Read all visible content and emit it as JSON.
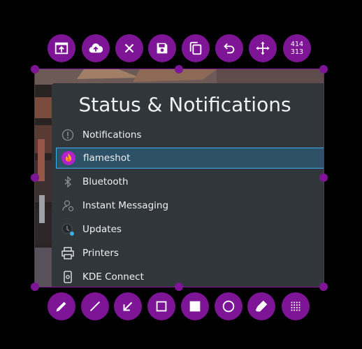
{
  "colors": {
    "accent": "#7e1596",
    "panel": "#31363b",
    "selection": "#2d5166",
    "selection_border": "#3daee9"
  },
  "top_toolbar": {
    "buttons": [
      {
        "name": "upload-to-screen-icon"
      },
      {
        "name": "cloud-upload-icon"
      },
      {
        "name": "close-icon"
      },
      {
        "name": "save-icon"
      },
      {
        "name": "copy-icon"
      },
      {
        "name": "undo-icon"
      },
      {
        "name": "move-icon"
      }
    ],
    "size": {
      "width": "414",
      "height": "313"
    }
  },
  "panel": {
    "title": "Status & Notifications",
    "items": [
      {
        "label": "Notifications",
        "icon": "info-circle-icon"
      },
      {
        "label": "flameshot",
        "icon": "flameshot-icon",
        "selected": true
      },
      {
        "label": "Bluetooth",
        "icon": "bluetooth-icon"
      },
      {
        "label": "Instant Messaging",
        "icon": "user-icon"
      },
      {
        "label": "Updates",
        "icon": "updates-icon"
      },
      {
        "label": "Printers",
        "icon": "printer-icon"
      },
      {
        "label": "KDE Connect",
        "icon": "phone-icon"
      }
    ]
  },
  "tools": [
    {
      "name": "pencil-tool-icon"
    },
    {
      "name": "line-tool-icon"
    },
    {
      "name": "arrow-tool-icon"
    },
    {
      "name": "rectangle-tool-icon"
    },
    {
      "name": "filled-rectangle-tool-icon"
    },
    {
      "name": "circle-tool-icon"
    },
    {
      "name": "marker-tool-icon"
    },
    {
      "name": "pixelate-tool-icon"
    }
  ]
}
